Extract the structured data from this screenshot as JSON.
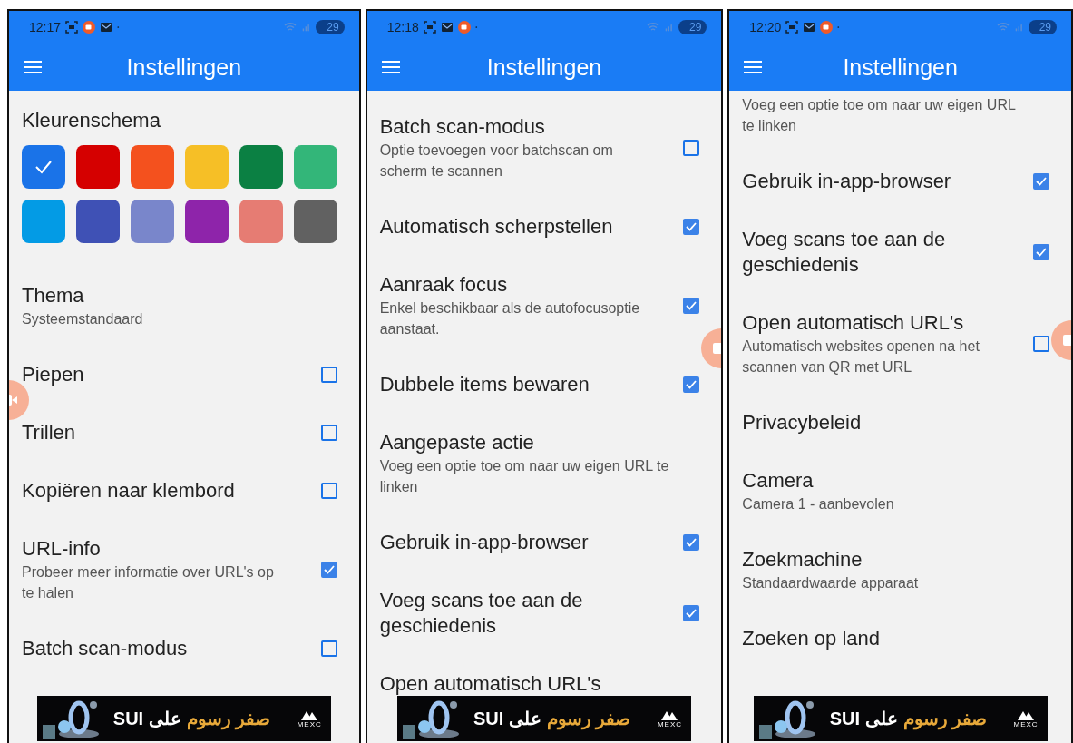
{
  "screens": [
    {
      "status_bar": {
        "time": "12:17",
        "icons": [
          {
            "kind": "screenshot"
          },
          {
            "kind": "recorder"
          },
          {
            "kind": "mail"
          }
        ],
        "battery": "29"
      },
      "app_bar": {
        "title": "Instellingen"
      },
      "color_scheme": {
        "title": "Kleurenschema",
        "colors": [
          {
            "color": "#1a73e8",
            "selected": true
          },
          {
            "color": "#d50000",
            "selected": false
          },
          {
            "color": "#f4511e",
            "selected": false
          },
          {
            "color": "#f6bf26",
            "selected": false
          },
          {
            "color": "#0b8043",
            "selected": false
          },
          {
            "color": "#33b679",
            "selected": false
          },
          {
            "color": "#039be5",
            "selected": false
          },
          {
            "color": "#3f51b5",
            "selected": false
          },
          {
            "color": "#7986cb",
            "selected": false
          },
          {
            "color": "#8e24aa",
            "selected": false
          },
          {
            "color": "#e67c73",
            "selected": false
          },
          {
            "color": "#616161",
            "selected": false
          }
        ]
      },
      "settings": [
        {
          "kind": "plain",
          "title": "Thema",
          "subtitle": "Systeemstandaard"
        },
        {
          "kind": "checkbox",
          "title": "Piepen",
          "checked": false
        },
        {
          "kind": "checkbox",
          "title": "Trillen",
          "checked": false
        },
        {
          "kind": "checkbox",
          "title": "Kopiëren naar klembord",
          "checked": false
        },
        {
          "kind": "checkbox",
          "title": "URL-info",
          "subtitle": "Probeer meer informatie over URL's op te halen",
          "checked": true
        },
        {
          "kind": "checkbox",
          "title": "Batch scan-modus",
          "checked": false
        }
      ],
      "ad": {
        "highlight": "صفر رسوم",
        "text": "على SUI",
        "brand": "MEXC"
      }
    },
    {
      "status_bar": {
        "time": "12:18",
        "icons": [
          {
            "kind": "screenshot"
          },
          {
            "kind": "mail"
          },
          {
            "kind": "recorder"
          }
        ],
        "battery": "29"
      },
      "app_bar": {
        "title": "Instellingen"
      },
      "settings": [
        {
          "kind": "checkbox",
          "title": "Batch scan-modus",
          "subtitle": "Optie toevoegen voor batchscan om scherm te scannen",
          "checked": false
        },
        {
          "kind": "checkbox",
          "title": "Automatisch scherpstellen",
          "checked": true
        },
        {
          "kind": "checkbox",
          "title": "Aanraak focus",
          "subtitle": "Enkel beschikbaar als de autofocusoptie aanstaat.",
          "checked": true
        },
        {
          "kind": "checkbox",
          "title": "Dubbele items bewaren",
          "checked": true
        },
        {
          "kind": "plain",
          "title": "Aangepaste actie",
          "subtitle": "Voeg een optie toe om naar uw eigen URL te linken"
        },
        {
          "kind": "checkbox",
          "title": "Gebruik in-app-browser",
          "checked": true
        },
        {
          "kind": "checkbox",
          "title": "Voeg scans toe aan de geschiedenis",
          "checked": true
        },
        {
          "kind": "plain",
          "title": "Open automatisch URL's"
        }
      ],
      "ad": {
        "highlight": "صفر رسوم",
        "text": "على SUI",
        "brand": "MEXC"
      }
    },
    {
      "status_bar": {
        "time": "12:20",
        "icons": [
          {
            "kind": "screenshot"
          },
          {
            "kind": "mail"
          },
          {
            "kind": "recorder"
          }
        ],
        "battery": "29"
      },
      "app_bar": {
        "title": "Instellingen"
      },
      "settings": [
        {
          "kind": "plain",
          "subtitle": "Voeg een optie toe om naar uw eigen URL te linken"
        },
        {
          "kind": "checkbox",
          "title": "Gebruik in-app-browser",
          "checked": true
        },
        {
          "kind": "checkbox",
          "title": "Voeg scans toe aan de geschiedenis",
          "checked": true
        },
        {
          "kind": "checkbox",
          "title": "Open automatisch URL's",
          "subtitle": "Automatisch websites openen na het scannen van QR met URL",
          "checked": false
        },
        {
          "kind": "plain",
          "title": "Privacybeleid"
        },
        {
          "kind": "plain",
          "title": "Camera",
          "subtitle": "Camera 1 - aanbevolen"
        },
        {
          "kind": "plain",
          "title": "Zoekmachine",
          "subtitle": "Standaardwaarde apparaat"
        },
        {
          "kind": "plain",
          "title": "Zoeken op land"
        }
      ],
      "ad": {
        "highlight": "صفر رسوم",
        "text": "على SUI",
        "brand": "MEXC"
      }
    }
  ]
}
